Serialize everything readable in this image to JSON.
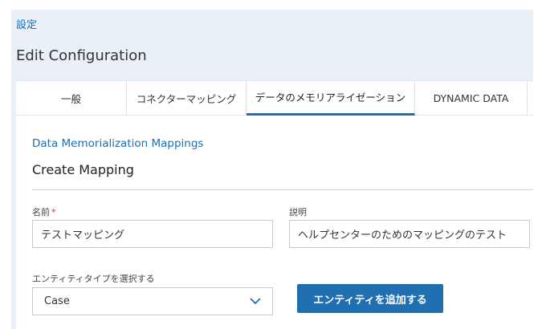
{
  "breadcrumb": {
    "label": "設定"
  },
  "page": {
    "title": "Edit Configuration"
  },
  "tabs": [
    {
      "label": "一般"
    },
    {
      "label": "コネクターマッピング"
    },
    {
      "label": "データのメモリアライゼーション",
      "active": true
    },
    {
      "label": "DYNAMIC DATA"
    }
  ],
  "section": {
    "link": "Data Memorialization Mappings",
    "title": "Create Mapping"
  },
  "form": {
    "name_label": "名前",
    "name_required": "*",
    "name_value": "テストマッピング",
    "description_label": "説明",
    "description_value": "ヘルプセンターのためのマッピングのテスト",
    "entity_type_label": "エンティティタイプを選択する",
    "entity_type_value": "Case",
    "add_entity_button": "エンティティを追加する"
  },
  "colors": {
    "accent": "#1f6fb2",
    "header_bg": "#e9f0f7",
    "required": "#c0392b"
  },
  "icons": {
    "select_arrow": "chevron-down-icon"
  }
}
